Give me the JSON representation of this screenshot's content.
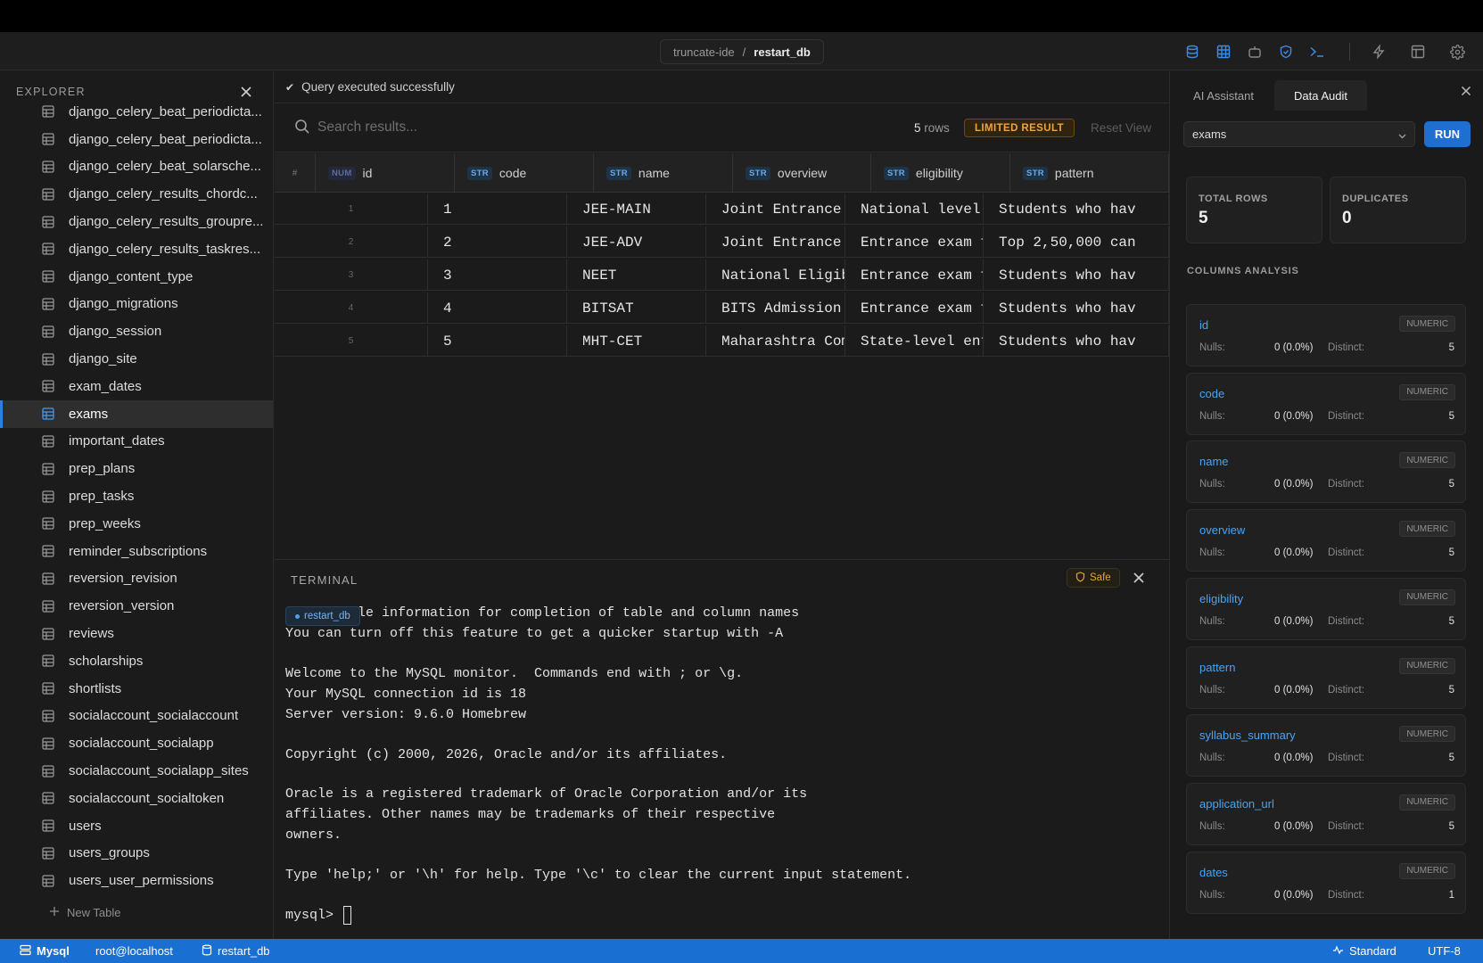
{
  "titlebar": {
    "crumb_parent": "truncate-ide",
    "crumb_separator": "/",
    "crumb_current": "restart_db",
    "icons": [
      "database-icon",
      "table-icon",
      "robot-icon",
      "shield-icon",
      "terminal-icon",
      "lightning-icon",
      "layout-icon",
      "gear-icon"
    ]
  },
  "explorer": {
    "title": "EXPLORER",
    "new_table_label": "New Table",
    "items": [
      "django_celery_beat_periodicta...",
      "django_celery_beat_periodicta...",
      "django_celery_beat_solarsche...",
      "django_celery_results_chordc...",
      "django_celery_results_groupre...",
      "django_celery_results_taskres...",
      "django_content_type",
      "django_migrations",
      "django_session",
      "django_site",
      "exam_dates",
      "exams",
      "important_dates",
      "prep_plans",
      "prep_tasks",
      "prep_weeks",
      "reminder_subscriptions",
      "reversion_revision",
      "reversion_version",
      "reviews",
      "scholarships",
      "shortlists",
      "socialaccount_socialaccount",
      "socialaccount_socialapp",
      "socialaccount_socialapp_sites",
      "socialaccount_socialtoken",
      "users",
      "users_groups",
      "users_user_permissions"
    ],
    "active_item": "exams"
  },
  "query": {
    "status_icon": "✔",
    "status_text": "Query executed successfully",
    "search_placeholder": "Search results...",
    "row_count_value": "5",
    "row_count_label": "rows",
    "limited_label": "LIMITED RESULT",
    "reset_label": "Reset View"
  },
  "grid": {
    "rownum_header": "#",
    "columns": [
      {
        "type": "NUM",
        "name": "id"
      },
      {
        "type": "STR",
        "name": "code"
      },
      {
        "type": "STR",
        "name": "name"
      },
      {
        "type": "STR",
        "name": "overview"
      },
      {
        "type": "STR",
        "name": "eligibility"
      },
      {
        "type": "STR",
        "name": "pattern"
      }
    ],
    "rows": [
      {
        "n": "1",
        "cells": [
          "1",
          "JEE-MAIN",
          "Joint Entrance E",
          "National level e",
          "Students who hav"
        ]
      },
      {
        "n": "2",
        "cells": [
          "2",
          "JEE-ADV",
          "Joint Entrance E",
          "Entrance exam fo",
          "Top 2,50,000 can"
        ]
      },
      {
        "n": "3",
        "cells": [
          "3",
          "NEET",
          "National Eligibi",
          "Entrance exam fo",
          "Students who hav"
        ]
      },
      {
        "n": "4",
        "cells": [
          "4",
          "BITSAT",
          "BITS Admission T",
          "Entrance exam fo",
          "Students who hav"
        ]
      },
      {
        "n": "5",
        "cells": [
          "5",
          "MHT-CET",
          "Maharashtra Comm",
          "State-level entr",
          "Students who hav"
        ]
      }
    ]
  },
  "terminal": {
    "title": "TERMINAL",
    "safe_label": "Safe",
    "db_tag": "restart_db",
    "lines": [
      "         le information for completion of table and column names",
      "You can turn off this feature to get a quicker startup with -A",
      "",
      "Welcome to the MySQL monitor.  Commands end with ; or \\g.",
      "Your MySQL connection id is 18",
      "Server version: 9.6.0 Homebrew",
      "",
      "Copyright (c) 2000, 2026, Oracle and/or its affiliates.",
      "",
      "Oracle is a registered trademark of Oracle Corporation and/or its",
      "affiliates. Other names may be trademarks of their respective",
      "owners.",
      "",
      "Type 'help;' or '\\h' for help. Type '\\c' to clear the current input statement.",
      ""
    ],
    "prompt": "mysql> "
  },
  "audit": {
    "tab_ai": "AI Assistant",
    "tab_audit": "Data Audit",
    "table_select": "exams",
    "run_label": "RUN",
    "total_rows_label": "TOTAL ROWS",
    "total_rows_value": "5",
    "duplicates_label": "DUPLICATES",
    "duplicates_value": "0",
    "columns_heading": "COLUMNS ANALYSIS",
    "nulls_label": "Nulls:",
    "distinct_label": "Distinct:",
    "columns": [
      {
        "name": "id",
        "type": "NUMERIC",
        "nulls": "0 (0.0%)",
        "distinct": "5"
      },
      {
        "name": "code",
        "type": "NUMERIC",
        "nulls": "0 (0.0%)",
        "distinct": "5"
      },
      {
        "name": "name",
        "type": "NUMERIC",
        "nulls": "0 (0.0%)",
        "distinct": "5"
      },
      {
        "name": "overview",
        "type": "NUMERIC",
        "nulls": "0 (0.0%)",
        "distinct": "5"
      },
      {
        "name": "eligibility",
        "type": "NUMERIC",
        "nulls": "0 (0.0%)",
        "distinct": "5"
      },
      {
        "name": "pattern",
        "type": "NUMERIC",
        "nulls": "0 (0.0%)",
        "distinct": "5"
      },
      {
        "name": "syllabus_summary",
        "type": "NUMERIC",
        "nulls": "0 (0.0%)",
        "distinct": "5"
      },
      {
        "name": "application_url",
        "type": "NUMERIC",
        "nulls": "0 (0.0%)",
        "distinct": "5"
      },
      {
        "name": "dates",
        "type": "NUMERIC",
        "nulls": "0 (0.0%)",
        "distinct": "1"
      }
    ]
  },
  "statusbar": {
    "engine": "Mysql",
    "host": "root@localhost",
    "database": "restart_db",
    "mode": "Standard",
    "encoding": "UTF-8"
  },
  "colors": {
    "accent": "#1a6fd3",
    "warning": "#f0a33a",
    "link": "#4aa3f2"
  }
}
